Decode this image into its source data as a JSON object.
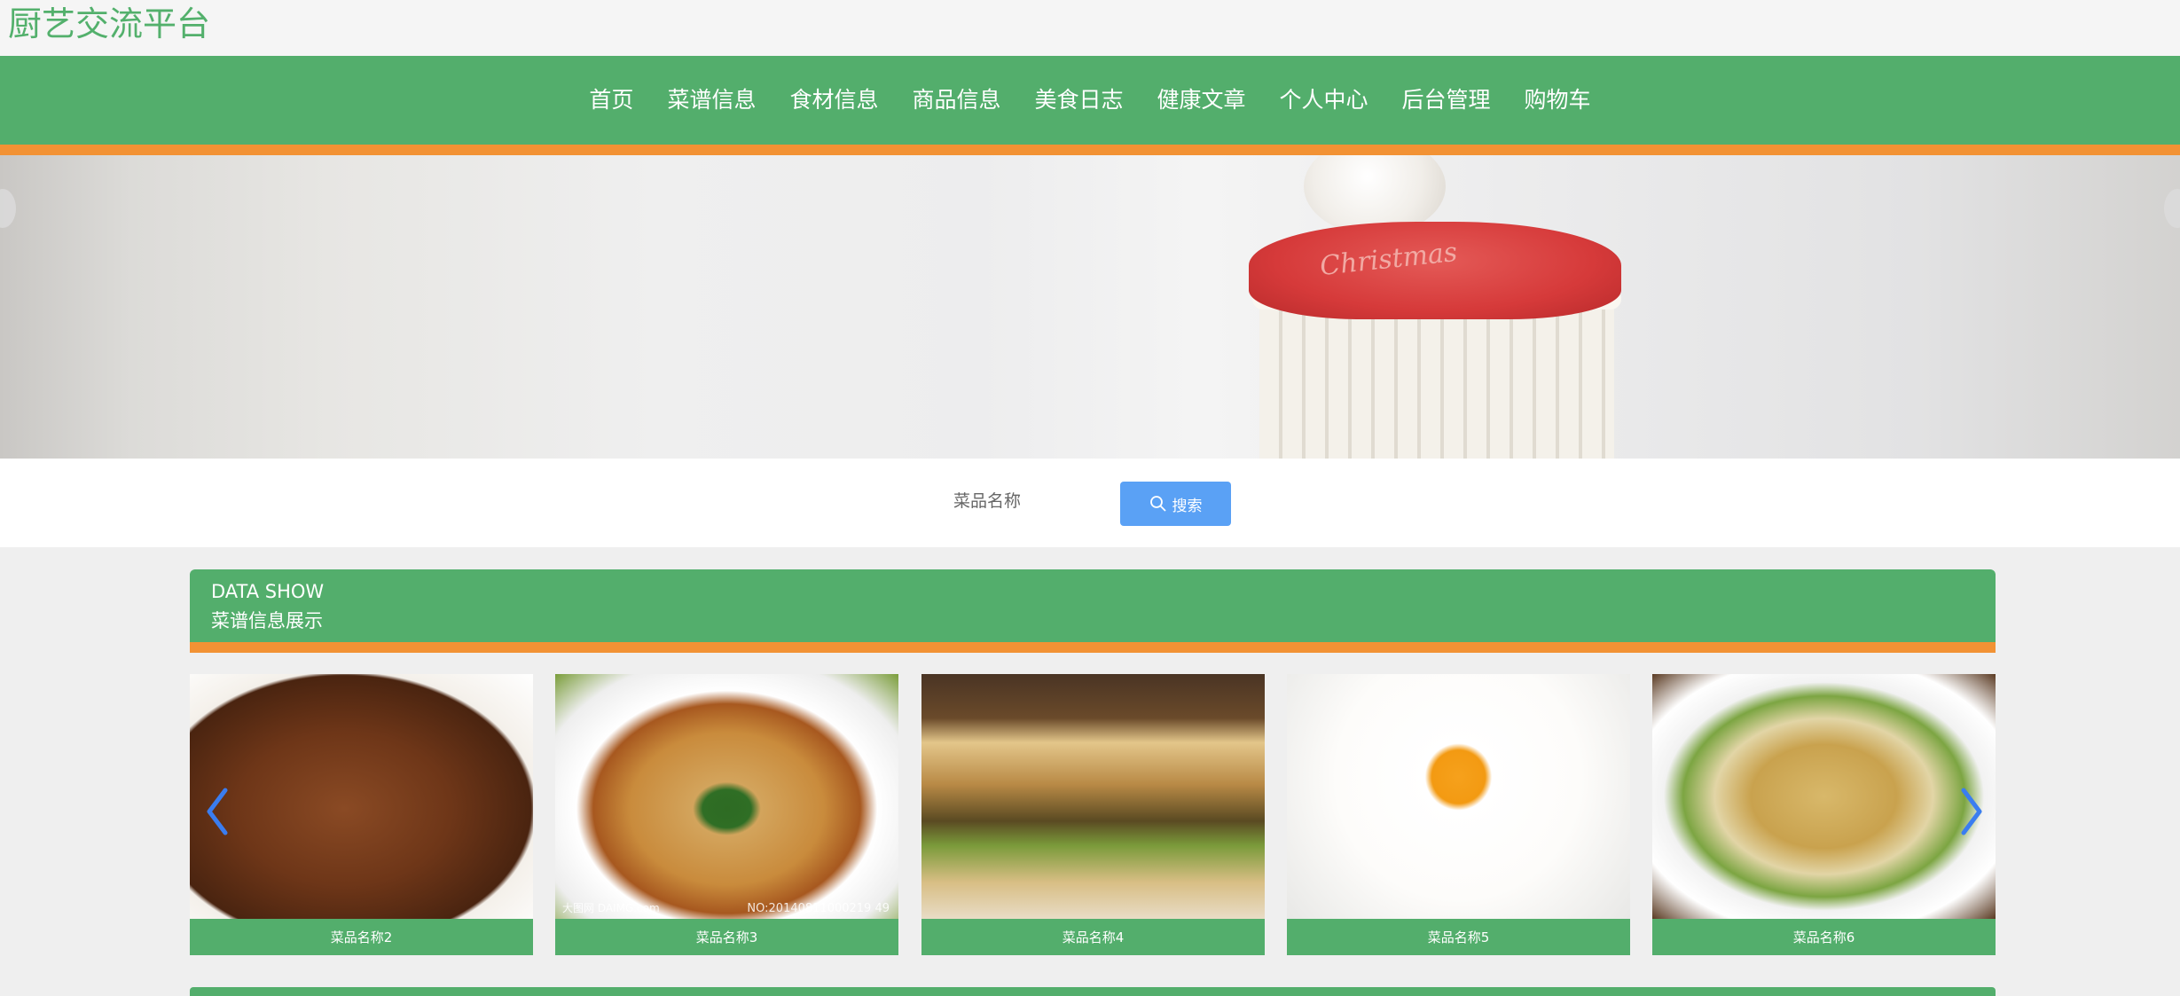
{
  "site": {
    "title": "厨艺交流平台"
  },
  "nav": {
    "items": [
      {
        "label": "首页"
      },
      {
        "label": "菜谱信息"
      },
      {
        "label": "食材信息"
      },
      {
        "label": "商品信息"
      },
      {
        "label": "美食日志"
      },
      {
        "label": "健康文章"
      },
      {
        "label": "个人中心"
      },
      {
        "label": "后台管理"
      },
      {
        "label": "购物车"
      }
    ]
  },
  "banner": {
    "cake_text": "Christmas",
    "slides_count": 4,
    "active_slide": 1
  },
  "search": {
    "placeholder": "菜品名称",
    "button_label": "搜索"
  },
  "section": {
    "title_en": "DATA SHOW",
    "title_cn": "菜谱信息展示"
  },
  "recipes": [
    {
      "name": "菜品名称2"
    },
    {
      "name": "菜品名称3",
      "watermark": "大图网 DAIMG.com",
      "code": "NO:20140811000219 49"
    },
    {
      "name": "菜品名称4"
    },
    {
      "name": "菜品名称5"
    },
    {
      "name": "菜品名称6"
    }
  ],
  "colors": {
    "brand_green": "#53ae6c",
    "accent_orange": "#f29234",
    "search_blue": "#5aa1f5"
  }
}
